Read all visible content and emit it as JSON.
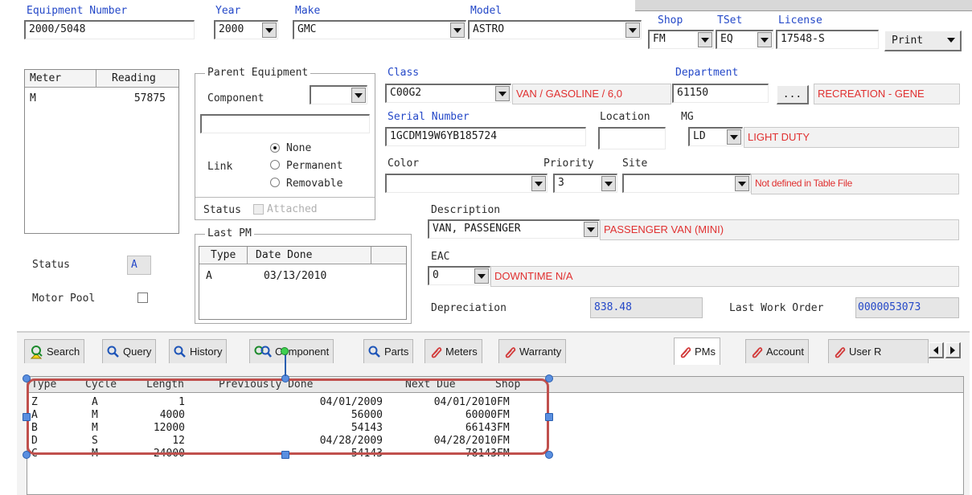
{
  "header": {
    "equipment_number_label": "Equipment Number",
    "equipment_number": "2000/5048",
    "year_label": "Year",
    "year": "2000",
    "make_label": "Make",
    "make": "GMC",
    "model_label": "Model",
    "model": "ASTRO",
    "shop_label": "Shop",
    "shop": "FM",
    "tset_label": "TSet",
    "tset": "EQ",
    "license_label": "License",
    "license": "17548-S",
    "print_label": "Print"
  },
  "meters": {
    "col_meter": "Meter",
    "col_reading": "Reading",
    "rows": [
      {
        "meter": "M",
        "reading": "57875"
      }
    ]
  },
  "parent_equipment": {
    "title": "Parent Equipment",
    "component_label": "Component",
    "component_value": "",
    "link_label": "Link",
    "options": [
      "None",
      "Permanent",
      "Removable"
    ],
    "selected": "None",
    "status_label": "Status",
    "attached_label": "Attached"
  },
  "class": {
    "label": "Class",
    "value": "C00G2",
    "description": "VAN / GASOLINE / 6,0"
  },
  "department": {
    "label": "Department",
    "value": "61150",
    "browse_label": "...",
    "description": "RECREATION - GENE"
  },
  "serial": {
    "label": "Serial Number",
    "value": "1GCDM19W6YB185724"
  },
  "location": {
    "label": "Location",
    "value": ""
  },
  "mg": {
    "label": "MG",
    "value": "LD",
    "description": "LIGHT DUTY"
  },
  "color": {
    "label": "Color",
    "value": ""
  },
  "priority": {
    "label": "Priority",
    "value": "3"
  },
  "site": {
    "label": "Site",
    "value": "",
    "description": "Not defined in Table File"
  },
  "description": {
    "label": "Description",
    "value": "VAN, PASSENGER",
    "text": "PASSENGER VAN (MINI)"
  },
  "last_pm": {
    "title": "Last PM",
    "col_type": "Type",
    "col_date": "Date Done",
    "rows": [
      {
        "type": "A",
        "date": "03/13/2010"
      }
    ]
  },
  "eac": {
    "label": "EAC",
    "value": "0",
    "description": "DOWNTIME N/A"
  },
  "status": {
    "label": "Status",
    "value": "A"
  },
  "motor_pool": {
    "label": "Motor Pool"
  },
  "depreciation": {
    "label": "Depreciation",
    "value": "838.48"
  },
  "last_work_order": {
    "label": "Last Work Order",
    "value": "0000053073"
  },
  "tabs": [
    {
      "label": "Search",
      "icon": "search-icon"
    },
    {
      "label": "Query",
      "icon": "magnifier-icon"
    },
    {
      "label": "History",
      "icon": "magnifier-icon"
    },
    {
      "label": "Component",
      "icon": "magnifier-icon"
    },
    {
      "label": "Parts",
      "icon": "magnifier-icon"
    },
    {
      "label": "Meters",
      "icon": "paperclip-icon"
    },
    {
      "label": "Warranty",
      "icon": "paperclip-icon"
    },
    {
      "label": "PMs",
      "icon": "paperclip-icon"
    },
    {
      "label": "Account",
      "icon": "paperclip-icon"
    },
    {
      "label": "User R",
      "icon": "paperclip-icon"
    }
  ],
  "pm_grid": {
    "columns": [
      "Type",
      "Cycle",
      "Length",
      "Previously Done",
      "Next Due",
      "Shop"
    ],
    "rows": [
      {
        "type": "Z",
        "cycle": "A",
        "length": "1",
        "prev": "04/01/2009",
        "next": "04/01/2010",
        "shop": "FM"
      },
      {
        "type": "A",
        "cycle": "M",
        "length": "4000",
        "prev": "56000",
        "next": "60000",
        "shop": "FM"
      },
      {
        "type": "B",
        "cycle": "M",
        "length": "12000",
        "prev": "54143",
        "next": "66143",
        "shop": "FM"
      },
      {
        "type": "D",
        "cycle": "S",
        "length": "12",
        "prev": "04/28/2009",
        "next": "04/28/2010",
        "shop": "FM"
      },
      {
        "type": "C",
        "cycle": "M",
        "length": "24000",
        "prev": "54143",
        "next": "78143",
        "shop": "FM"
      }
    ]
  },
  "colors": {
    "label_blue": "#2448c8",
    "red_text": "#e03030",
    "highlight": "#c0504d"
  }
}
